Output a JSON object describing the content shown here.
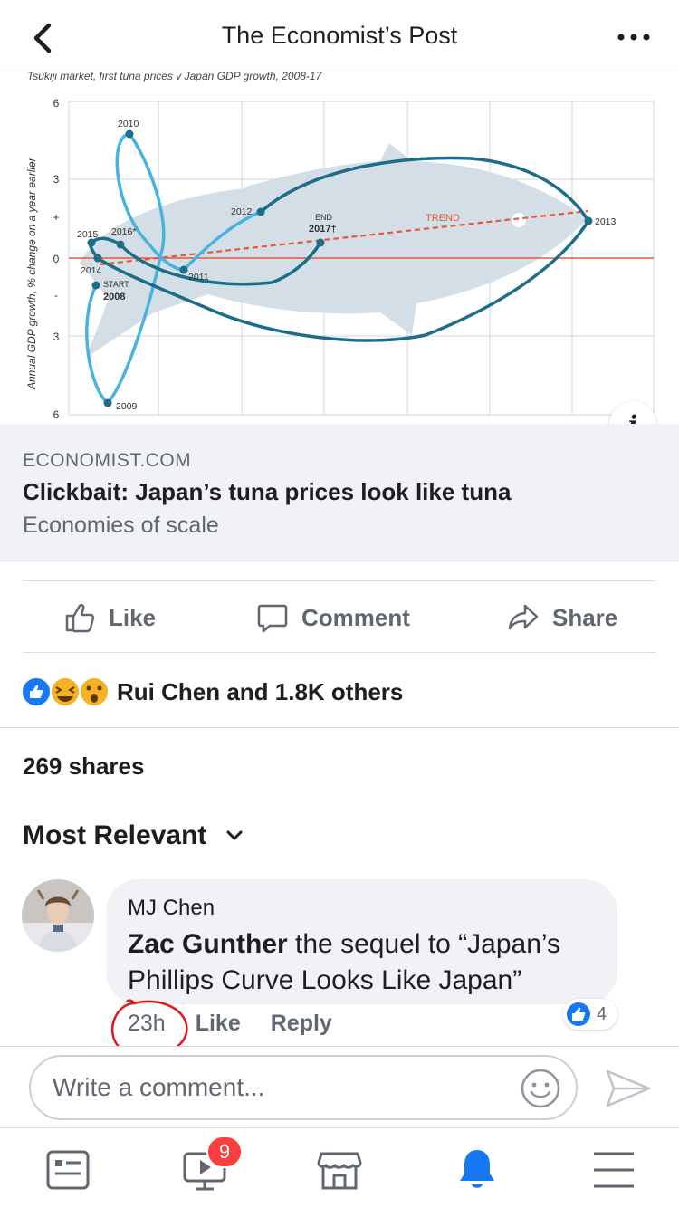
{
  "header": {
    "title": "The Economist’s Post"
  },
  "chart": {
    "caption": "Tsukiji market, first tuna prices v Japan GDP growth, 2008-17",
    "ylabel": "Annual GDP growth, % change on a year earlier",
    "y_ticks": [
      "6",
      "3",
      "+",
      "0",
      "-",
      "3",
      "6"
    ],
    "point_labels": {
      "start": "START",
      "y2008": "2008",
      "y2009": "2009",
      "y2010": "2010",
      "y2011": "2011",
      "y2012": "2012",
      "y2013": "2013",
      "y2014": "2014",
      "y2015": "2015",
      "y2016": "2016*",
      "end": "END",
      "y2017": "2017†"
    },
    "trend_label": "TREND"
  },
  "chart_data": {
    "type": "line",
    "title": "Tsukiji market, first tuna prices v Japan GDP growth, 2008-17",
    "ylabel": "Annual GDP growth, % change on a year earlier",
    "ylim": [
      -6,
      6
    ],
    "grid": true,
    "series": [
      {
        "points": [
          {
            "label": "2008",
            "x": 8,
            "y": -1.0
          },
          {
            "label": "2009",
            "x": 13,
            "y": -5.5
          },
          {
            "label": "2010",
            "x": 22,
            "y": 4.7
          },
          {
            "label": "2011",
            "x": 42,
            "y": -0.5
          },
          {
            "label": "2012",
            "x": 66,
            "y": 1.7
          },
          {
            "label": "2013",
            "x": 180,
            "y": 1.4
          },
          {
            "label": "2014",
            "x": 9,
            "y": 0.0
          },
          {
            "label": "2015",
            "x": 7,
            "y": 0.6
          },
          {
            "label": "2016*",
            "x": 22,
            "y": 0.5
          },
          {
            "label": "2017†",
            "x": 85,
            "y": 0.6
          }
        ]
      }
    ]
  },
  "link": {
    "domain": "ECONOMIST.COM",
    "headline": "Clickbait: Japan’s tuna prices look like tuna",
    "subtitle": "Economies of scale"
  },
  "actions": {
    "like": "Like",
    "comment": "Comment",
    "share": "Share"
  },
  "reactions": {
    "summary": "Rui Chen and 1.8K others"
  },
  "shares": "269 shares",
  "comments": {
    "sort_label": "Most Relevant",
    "items": [
      {
        "author": "MJ Chen",
        "mention": "Zac Gunther",
        "text": " the sequel to “Japan’s Phillips Curve Looks Like Japan”",
        "time": "23h",
        "like": "Like",
        "reply": "Reply",
        "likes": "4"
      }
    ]
  },
  "comment_input": {
    "placeholder": "Write a comment..."
  },
  "nav": {
    "video_badge": "9",
    "active": "notifications"
  },
  "colors": {
    "fb_blue": "#1877f2",
    "chart_dark": "#1b6d8a",
    "chart_light": "#49b3de",
    "trend": "#e5583c",
    "badge": "#fa3e3e"
  }
}
